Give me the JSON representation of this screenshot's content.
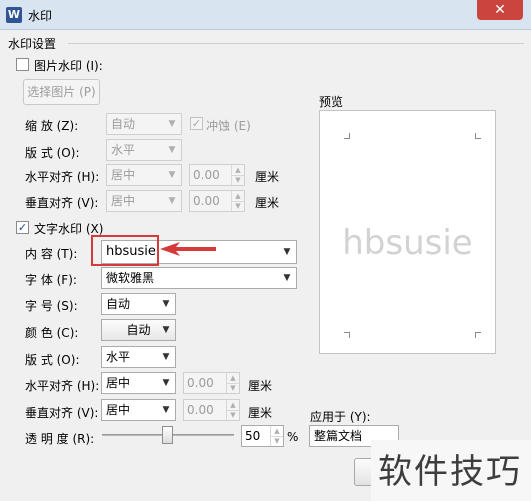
{
  "window": {
    "title": "水印",
    "app_icon_glyph": "W"
  },
  "group": {
    "label": "水印设置"
  },
  "picture_watermark": {
    "checkbox_label": "图片水印 (I):",
    "checked": false,
    "select_button": "选择图片 (P)",
    "scale_label": "缩  放 (Z):",
    "scale_value": "自动",
    "washout_label": "冲蚀 (E)",
    "layout_label": "版  式 (O):",
    "layout_value": "水平",
    "h_align_label": "水平对齐 (H):",
    "h_align_value": "居中",
    "h_offset": "0.00",
    "h_unit": "厘米",
    "v_align_label": "垂直对齐 (V):",
    "v_align_value": "居中",
    "v_offset": "0.00",
    "v_unit": "厘米"
  },
  "text_watermark": {
    "checkbox_label": "文字水印 (X)",
    "checked": true,
    "content_label": "内  容 (T):",
    "content_value": "hbsusie",
    "font_label": "字  体 (F):",
    "font_value": "微软雅黑",
    "size_label": "字  号 (S):",
    "size_value": "自动",
    "color_label": "颜  色 (C):",
    "color_value": "自动",
    "layout_label": "版  式 (O):",
    "layout_value": "水平",
    "h_align_label": "水平对齐 (H):",
    "h_align_value": "居中",
    "h_offset": "0.00",
    "h_unit": "厘米",
    "v_align_label": "垂直对齐 (V):",
    "v_align_value": "居中",
    "v_offset": "0.00",
    "v_unit": "厘米",
    "transparency_label": "透 明 度 (R):",
    "transparency_value": "50",
    "transparency_unit": "%"
  },
  "preview": {
    "label": "预览",
    "watermark_text": "hbsusie"
  },
  "apply_to": {
    "label": "应用于 (Y):",
    "value": "整篇文档"
  },
  "site_watermark": "软件技巧",
  "colors": {
    "highlight": "#d63a3a",
    "titlebar": "#d9e4f1",
    "close": "#c9453d"
  }
}
